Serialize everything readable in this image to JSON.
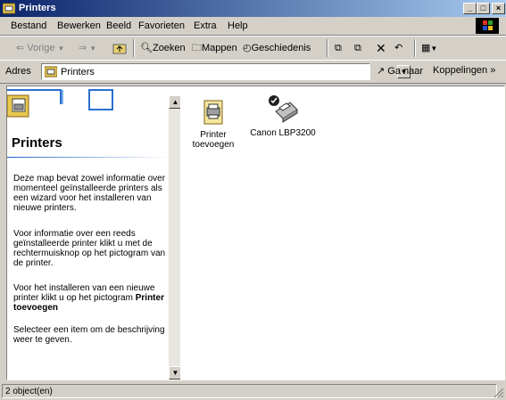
{
  "window": {
    "title": "Printers"
  },
  "menu": {
    "items": [
      {
        "label": "Bestand"
      },
      {
        "label": "Bewerken"
      },
      {
        "label": "Beeld"
      },
      {
        "label": "Favorieten"
      },
      {
        "label": "Extra"
      },
      {
        "label": "Help"
      }
    ]
  },
  "toolbar": {
    "back": "Vorige",
    "search": "Zoeken",
    "folders": "Mappen",
    "history": "Geschiedenis"
  },
  "address": {
    "label": "Adres",
    "value": "Printers",
    "go": "Ga naar",
    "links": "Koppelingen",
    "more": "»"
  },
  "leftpane": {
    "title": "Printers",
    "para1": "Deze map bevat zowel informatie over momenteel geïnstalleerde printers als een wizard voor het installeren van nieuwe printers.",
    "para2": "Voor informatie over een reeds geïnstalleerde printer klikt u met de rechtermuisknop op het pictogram van de printer.",
    "para3": "Voor het installeren van een nieuwe printer klikt u op het pictogram",
    "para3_bold": "Printer toevoegen",
    "para4": "Selecteer een item om de beschrijving weer te geven."
  },
  "files": [
    {
      "label_line1": "Printer",
      "label_line2": "toevoegen",
      "icon": "add-printer-icon"
    },
    {
      "label_line1": "Canon LBP3200",
      "label_line2": "",
      "icon": "printer-default-icon"
    }
  ],
  "status": {
    "text": "2 object(en)"
  }
}
